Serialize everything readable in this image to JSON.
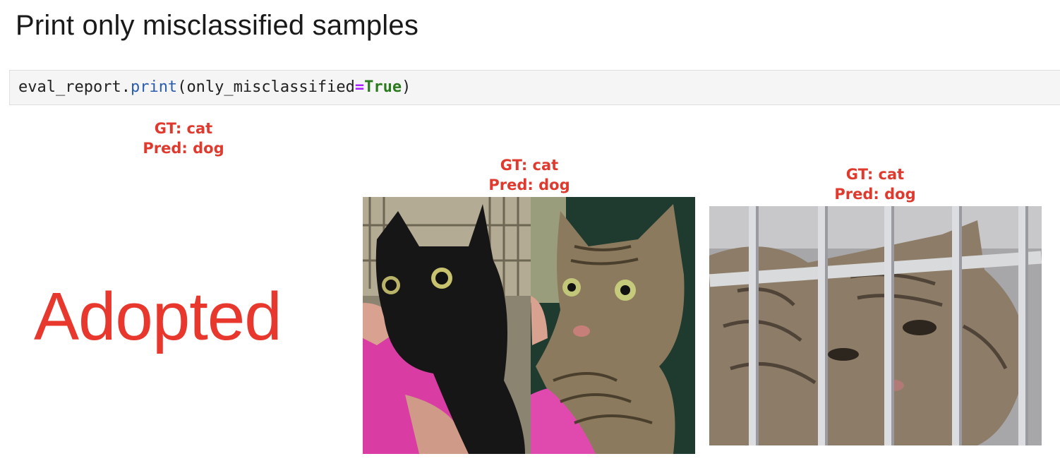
{
  "heading": "Print only misclassified samples",
  "code": {
    "object": "eval_report",
    "dot": ".",
    "function": "print",
    "open_paren": "(",
    "argument": "only_misclassified",
    "operator": "=",
    "value": "True",
    "close_paren": ")"
  },
  "samples": [
    {
      "gt": "GT: cat",
      "pred": "Pred: dog",
      "image": "adopted-logo-image",
      "image_text": "Adopted"
    },
    {
      "gt": "GT: cat",
      "pred": "Pred: dog",
      "image": "two-cats-photo"
    },
    {
      "gt": "GT: cat",
      "pred": "Pred: dog",
      "image": "caged-tabby-cat-photo"
    }
  ],
  "colors": {
    "label_red": "#e03a2f",
    "code_background": "#f5f5f5",
    "function_blue": "#2a5db0",
    "operator_purple": "#aa22ff",
    "keyword_green": "#2b7a1e"
  }
}
